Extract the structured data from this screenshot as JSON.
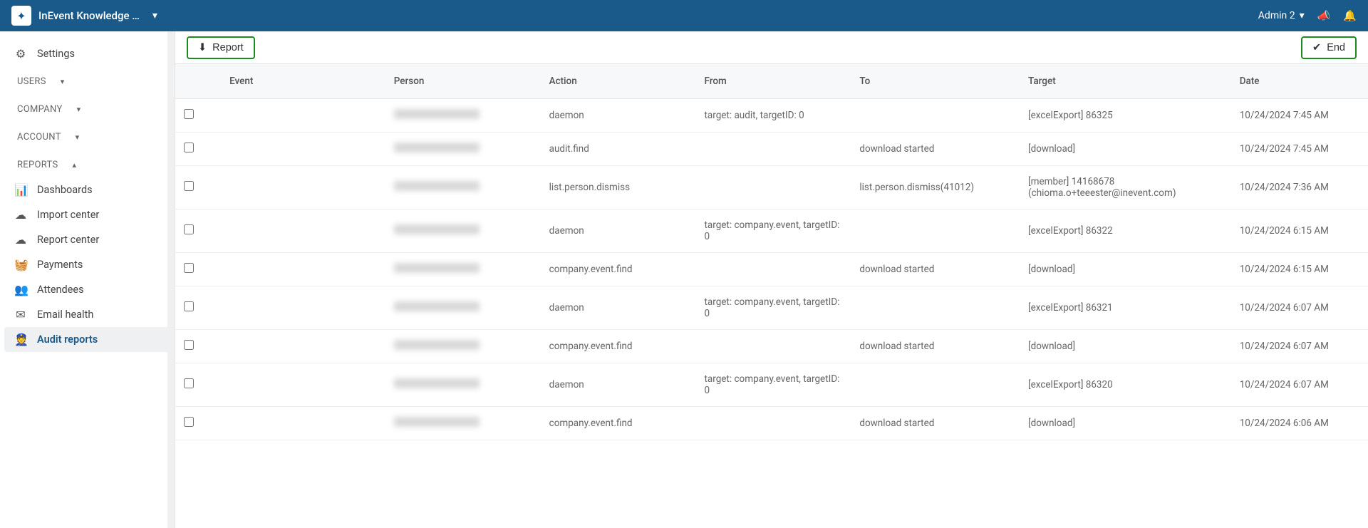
{
  "topbar": {
    "app_title": "InEvent Knowledge …",
    "user_name": "Admin 2"
  },
  "sidebar": {
    "settings_label": "Settings",
    "sections": {
      "users": "USERS",
      "company": "COMPANY",
      "account": "ACCOUNT",
      "reports": "REPORTS"
    },
    "reports_items": [
      {
        "label": "Dashboards",
        "icon": "dashboard"
      },
      {
        "label": "Import center",
        "icon": "import"
      },
      {
        "label": "Report center",
        "icon": "report"
      },
      {
        "label": "Payments",
        "icon": "payments"
      },
      {
        "label": "Attendees",
        "icon": "attendees"
      },
      {
        "label": "Email health",
        "icon": "email"
      },
      {
        "label": "Audit reports",
        "icon": "audit",
        "active": true
      }
    ]
  },
  "toolbar": {
    "report_label": "Report",
    "end_label": "End"
  },
  "table": {
    "headers": {
      "event": "Event",
      "person": "Person",
      "action": "Action",
      "from": "From",
      "to": "To",
      "target": "Target",
      "date": "Date"
    },
    "rows": [
      {
        "event": "",
        "action": "daemon",
        "from": "target: audit, targetID: 0",
        "to": "",
        "target": "[excelExport] 86325",
        "date": "10/24/2024 7:45 AM"
      },
      {
        "event": "",
        "action": "audit.find",
        "from": "",
        "to": "download started",
        "target": "[download]",
        "date": "10/24/2024 7:45 AM"
      },
      {
        "event": "",
        "action": "list.person.dismiss",
        "from": "",
        "to": "list.person.dismiss(41012)",
        "target": "[member] 14168678 (chioma.o+teeester@inevent.com)",
        "date": "10/24/2024 7:36 AM"
      },
      {
        "event": "",
        "action": "daemon",
        "from": "target: company.event, targetID: 0",
        "to": "",
        "target": "[excelExport] 86322",
        "date": "10/24/2024 6:15 AM"
      },
      {
        "event": "",
        "action": "company.event.find",
        "from": "",
        "to": "download started",
        "target": "[download]",
        "date": "10/24/2024 6:15 AM"
      },
      {
        "event": "",
        "action": "daemon",
        "from": "target: company.event, targetID: 0",
        "to": "",
        "target": "[excelExport] 86321",
        "date": "10/24/2024 6:07 AM"
      },
      {
        "event": "",
        "action": "company.event.find",
        "from": "",
        "to": "download started",
        "target": "[download]",
        "date": "10/24/2024 6:07 AM"
      },
      {
        "event": "",
        "action": "daemon",
        "from": "target: company.event, targetID: 0",
        "to": "",
        "target": "[excelExport] 86320",
        "date": "10/24/2024 6:07 AM"
      },
      {
        "event": "",
        "action": "company.event.find",
        "from": "",
        "to": "download started",
        "target": "[download]",
        "date": "10/24/2024 6:06 AM"
      }
    ]
  }
}
